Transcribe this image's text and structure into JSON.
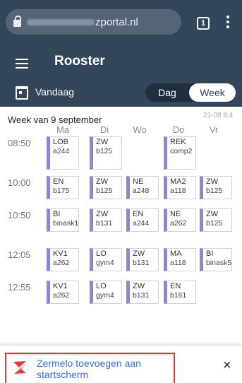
{
  "browser": {
    "url": "zportal.nl",
    "tab_count": "1"
  },
  "app": {
    "title": "Rooster"
  },
  "toolbar": {
    "today": "Vandaag",
    "day": "Dag",
    "week": "Week"
  },
  "schedule": {
    "week_title": "Week van 9 september",
    "timestamp": "21-08 8:4",
    "days": [
      "Ma",
      "Di",
      "Wo",
      "Do",
      "Vr"
    ],
    "times": [
      "08:50",
      "10:00",
      "10:50",
      "12:05",
      "12:55"
    ],
    "slots": [
      [
        {
          "subject": "LOB",
          "room": "a244"
        },
        {
          "subject": "ZW",
          "room": "b125"
        },
        null,
        {
          "subject": "REK",
          "room": "comp2"
        },
        null
      ],
      [
        {
          "subject": "EN",
          "room": "b175"
        },
        {
          "subject": "ZW",
          "room": "b125"
        },
        {
          "subject": "NE",
          "room": "a248"
        },
        {
          "subject": "MA2",
          "room": "a118"
        },
        {
          "subject": "ZW",
          "room": "b125"
        }
      ],
      [
        {
          "subject": "BI",
          "room": "binask1"
        },
        {
          "subject": "ZW",
          "room": "b131"
        },
        {
          "subject": "EN",
          "room": "a244"
        },
        {
          "subject": "NE",
          "room": "a262"
        },
        {
          "subject": "ZW",
          "room": "b125"
        }
      ],
      [
        {
          "subject": "KV1",
          "room": "a262"
        },
        {
          "subject": "LO",
          "room": "gym4"
        },
        {
          "subject": "ZW",
          "room": "b131"
        },
        {
          "subject": "MA",
          "room": "a118"
        },
        {
          "subject": "BI",
          "room": "binask5"
        }
      ],
      [
        {
          "subject": "KV1",
          "room": "a262"
        },
        {
          "subject": "LO",
          "room": "gym4"
        },
        {
          "subject": "ZW",
          "room": "b131"
        },
        {
          "subject": "EN",
          "room": "b161"
        },
        null
      ]
    ]
  },
  "banner": {
    "text": "Zermelo toevoegen aan startscherm",
    "close": "×"
  },
  "colors": {
    "header": "#34465a",
    "lesson_accent": "#8a88cf",
    "link": "#3a6fd8",
    "highlight": "#e53935"
  }
}
